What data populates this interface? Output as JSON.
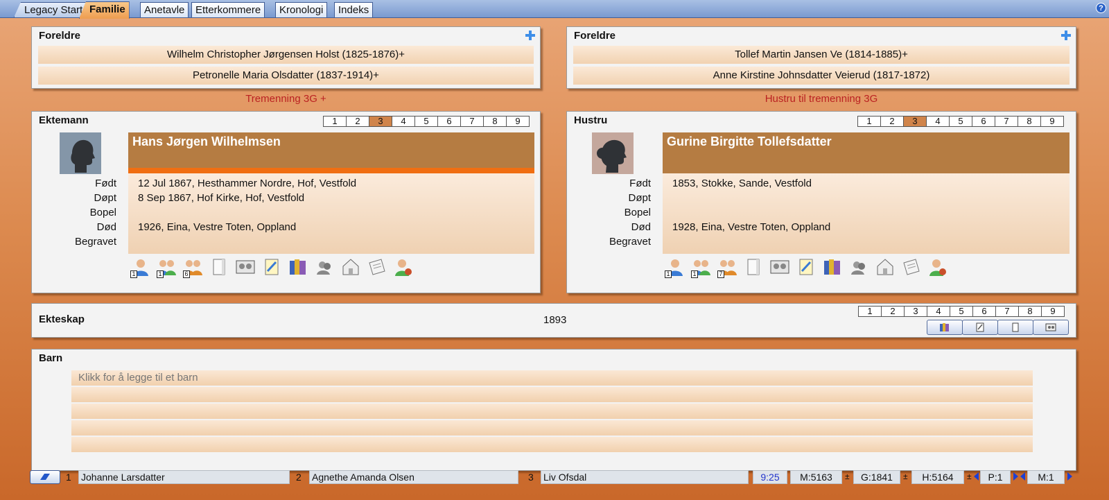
{
  "tabs": [
    {
      "label": "Legacy Start"
    },
    {
      "label": "Familie"
    },
    {
      "label": "Anetavle"
    },
    {
      "label": "Etterkommere"
    },
    {
      "label": "Kronologi"
    },
    {
      "label": "Indeks"
    }
  ],
  "help_label": "?",
  "left": {
    "parents_title": "Foreldre",
    "father": "Wilhelm Christopher Jørgensen Holst (1825-1876)+",
    "mother": "Petronelle Maria Olsdatter (1837-1914)+",
    "relationship": "Tremenning 3G +",
    "role": "Ektemann",
    "name": "Hans Jørgen Wilhelmsen",
    "event_labels": [
      "Født",
      "Døpt",
      "Bopel",
      "Død",
      "Begravet"
    ],
    "events": [
      "12 Jul 1867, Hesthammer Nordre, Hof, Vestfold",
      "8 Sep 1867, Hof Kirke, Hof, Vestfold",
      "",
      "1926, Eina, Vestre Toten, Oppland",
      ""
    ],
    "icon_counts": [
      "1",
      "1",
      "6"
    ]
  },
  "right": {
    "parents_title": "Foreldre",
    "father": "Tollef Martin Jansen Ve (1814-1885)+",
    "mother": "Anne Kirstine Johnsdatter Veierud (1817-1872)",
    "relationship": "Hustru til tremenning 3G",
    "role": "Hustru",
    "name": "Gurine Birgitte Tollefsdatter",
    "event_labels": [
      "Født",
      "Døpt",
      "Bopel",
      "Død",
      "Begravet"
    ],
    "events": [
      "1853, Stokke, Sande, Vestfold",
      "",
      "",
      "1928, Eina, Vestre Toten, Oppland",
      ""
    ],
    "icon_counts": [
      "1",
      "1",
      "7"
    ]
  },
  "numbers": [
    "1",
    "2",
    "3",
    "4",
    "5",
    "6",
    "7",
    "8",
    "9"
  ],
  "highlighted_number": "3",
  "marriage": {
    "title": "Ekteskap",
    "date": "1893"
  },
  "children": {
    "title": "Barn",
    "placeholder": "Klikk for å legge til et barn"
  },
  "icons": [
    "person-icon",
    "spouse-icon",
    "children-icon",
    "note-icon",
    "media-icon",
    "edit-note-icon",
    "sources-icon",
    "group-icon",
    "address-icon",
    "research-icon",
    "user-icon"
  ],
  "bottom": {
    "bookmarks": [
      {
        "num": "1",
        "name": "Johanne Larsdatter"
      },
      {
        "num": "2",
        "name": "Agnethe Amanda Olsen"
      },
      {
        "num": "3",
        "name": "Liv Ofsdal"
      }
    ],
    "time": "9:25",
    "m": "M:5163",
    "g": "G:1841",
    "h": "H:5164",
    "p": "P:1",
    "m2": "M:1",
    "pm": "±"
  },
  "colors": {
    "accent_orange": "#f06e12",
    "name_box": "#b57c42",
    "relationship_red": "#b22222",
    "tab_blue": "#7a9ad0"
  }
}
